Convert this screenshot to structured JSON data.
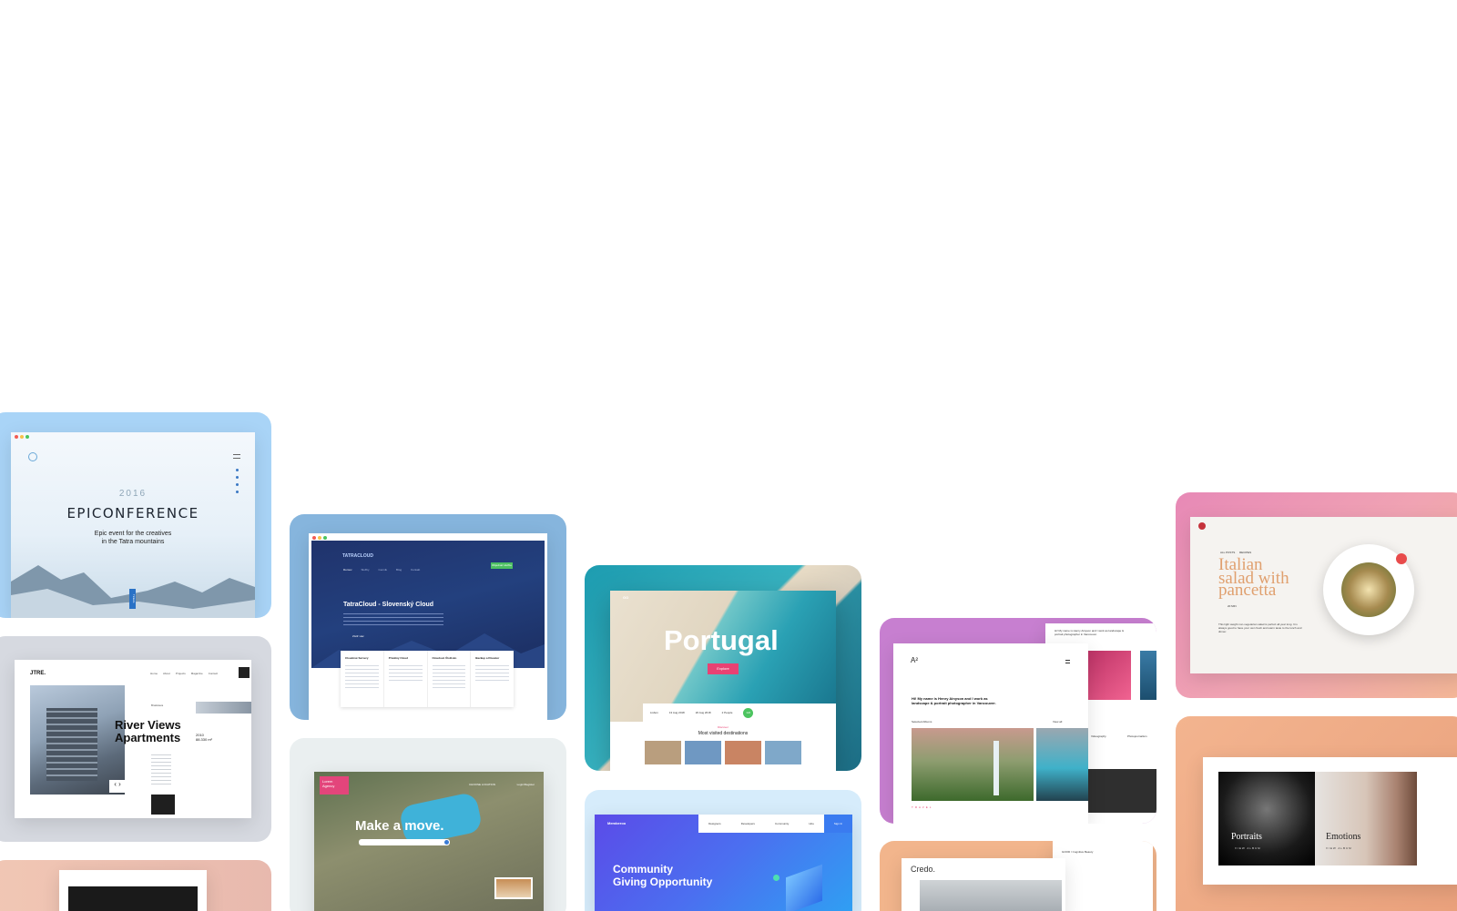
{
  "colors": {
    "blue_card": "#a9d4f7",
    "cloud_card": "#86b5dd",
    "gray_card": "#d6d9e0",
    "mint_card": "#eaeff0",
    "purple_card": "#c77fd0",
    "pink_card": "#f08fb7",
    "orange_card": "#f2b58c"
  },
  "epic": {
    "year": "2016",
    "title": "EPICONFERENCE",
    "subtitle_1": "Epic event for the creatives",
    "subtitle_2": "in the Tatra mountains",
    "tab": "Tickets"
  },
  "jtre": {
    "logo": "JTRE.",
    "nav": [
      "Home",
      "About",
      "Projects",
      "Magazine",
      "Contact"
    ],
    "kicker": "Bratislava",
    "title_1": "River Views",
    "title_2": "Apartments",
    "year": "2010",
    "area": "88.330 m²",
    "arrows": "‹ ›"
  },
  "cloud": {
    "logo": "TATRACLOUD",
    "heading": "TatraCloud - Slovenský Cloud",
    "nav": [
      "Domov",
      "Služby",
      "Cenník",
      "Blog",
      "Kontakt"
    ],
    "cta": "Objednať službu",
    "link": "Zistiť viac",
    "columns": [
      "Cloudové Servery",
      "Privátny Cloud",
      "Cloudové Úložisko",
      "Backup a Disaster"
    ]
  },
  "move": {
    "badge_1": "Lorem",
    "badge_2": "Agency",
    "title": "Make a move.",
    "location": "CHOOSE LOCATION",
    "login": "Login/Register"
  },
  "portugal": {
    "logo": "GO",
    "title": "Portugal",
    "explore": "Explore",
    "city": "Lisbon",
    "date_1": "13 Aug 2018",
    "date_2": "20 Aug 2018",
    "guests": "2 People",
    "go": "GO",
    "section_kicker": "Discover",
    "section_title": "Most visited destinations"
  },
  "community": {
    "logo": "Memberoo",
    "nav": [
      "Designers",
      "Developers",
      "Community",
      "Hire"
    ],
    "signin": "Sign In",
    "title_1": "Community",
    "title_2": "Giving Opportunity"
  },
  "henry": {
    "logo": "A²",
    "intro": "Hi! My name is Henry Ainyson and I work as landscape & portrait photographer in Vancouver.",
    "label": "Selected Albums",
    "view_all": "View all",
    "brand": "TRAVEL",
    "side_intro": "Hi! My name is Henry Ainyson and I work as landscape & portrait photographer in Vancouver.",
    "cat_1": "Videography",
    "cat_2": "Photojournalism"
  },
  "credo": {
    "logo": "Credo.",
    "side_title": "GOOD / Cognitive Beauty"
  },
  "salad": {
    "cat_1": "ALL POSTS",
    "cat_2": "RECIPES",
    "title_1": "Italian",
    "title_2": "salad with",
    "title_3": "pancetta",
    "time": "20 MIN",
    "body": "This light weight non-vegetarian salad is perfect all year long. It is always good to have your own fresh and warm taste to the lunch and dinner."
  },
  "gallery": {
    "label_1": "Portraits",
    "label_2": "Emotions",
    "view_1": "VIEW ALBUM",
    "view_2": "VIEW ALBUM"
  }
}
